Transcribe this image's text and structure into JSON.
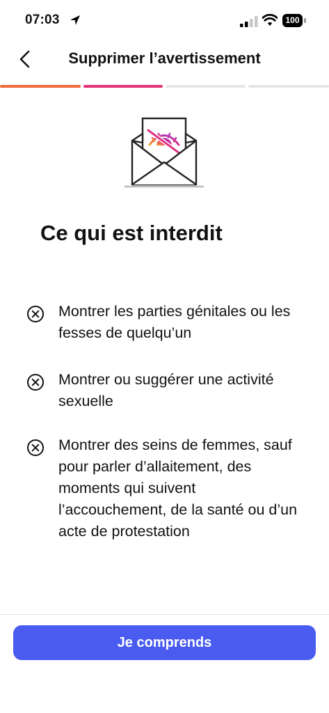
{
  "status_bar": {
    "time": "07:03",
    "battery": "100"
  },
  "nav": {
    "title": "Supprimer l’avertissement"
  },
  "progress": {
    "total_steps": 4,
    "completed_steps": 2,
    "colors": [
      "#ee6a3a",
      "#e4317a",
      "#e4e6ea",
      "#e4e6ea"
    ]
  },
  "illustration": {
    "icon": "envelope-with-hidden-eye-icon"
  },
  "content": {
    "heading": "Ce qui est interdit",
    "rules": [
      "Montrer les parties génitales ou les fesses de quelqu’un",
      "Montrer ou suggérer une activité sexuelle",
      "Montrer des seins de femmes, sauf pour parler d’allaitement, des moments qui suivent l’accouchement, de la santé ou d’un acte de protestation"
    ]
  },
  "footer": {
    "button_label": "Je comprends",
    "button_color": "#4a5cf0"
  }
}
